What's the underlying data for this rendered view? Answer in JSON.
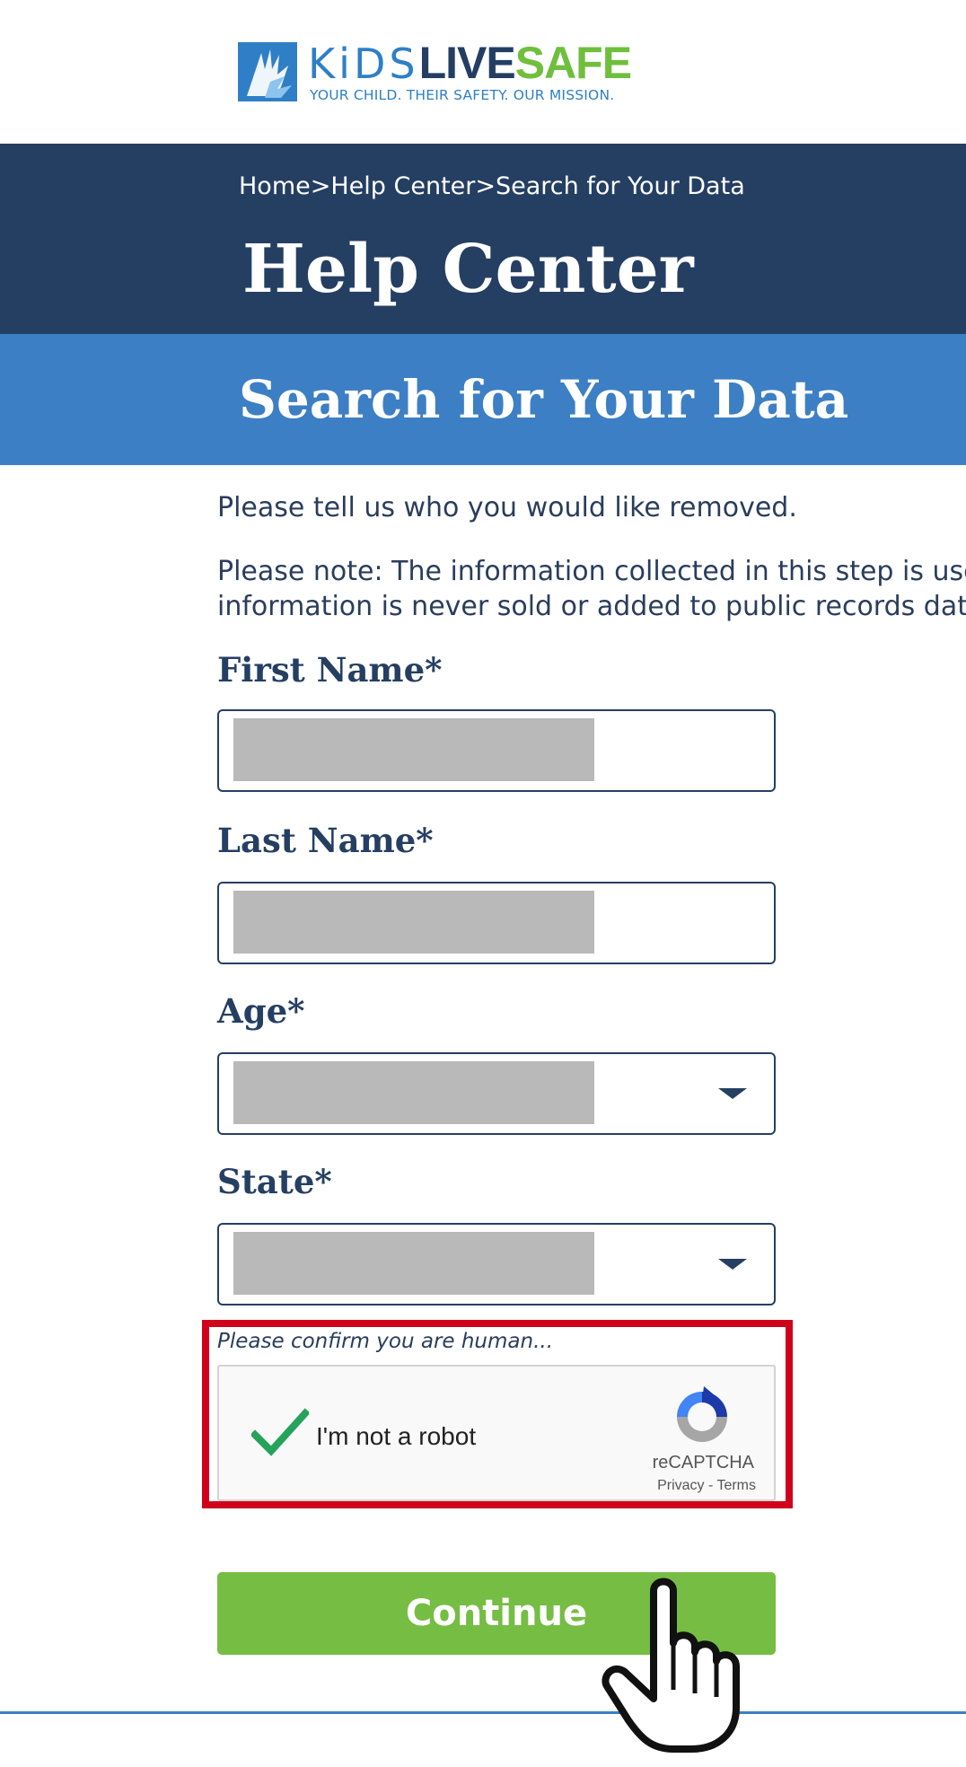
{
  "brand": {
    "kids": "KiDS",
    "live": "LIVE",
    "safe": "SAFE",
    "tagline": "YOUR CHILD. THEIR SAFETY. OUR MISSION.",
    "colors": {
      "blue": "#2f7fc6",
      "navy": "#243e63",
      "green": "#6fbf3d"
    }
  },
  "breadcrumb": {
    "home": "Home",
    "separator": ">",
    "help_center": "Help Center",
    "current": "Search for Your Data"
  },
  "header": {
    "title": "Help Center"
  },
  "section": {
    "title": "Search for Your Data"
  },
  "intro": "Please tell us who you would like removed.",
  "note": {
    "line1": "Please note: The information collected in this step is use",
    "line2": "information is never sold or added to public records data"
  },
  "form": {
    "first_name": {
      "label": "First Name*",
      "value": ""
    },
    "last_name": {
      "label": "Last Name*",
      "value": ""
    },
    "age": {
      "label": "Age*",
      "value": ""
    },
    "state": {
      "label": "State*",
      "value": ""
    }
  },
  "captcha": {
    "prompt": "Please confirm you are human...",
    "label": "I'm not a robot",
    "checked": true,
    "brand": "reCAPTCHA",
    "links": "Privacy - Terms"
  },
  "continue_label": "Continue",
  "colors": {
    "header_navy": "#253f63",
    "band_blue": "#3d7fc4",
    "button_green": "#75bd43",
    "highlight_red": "#d0021b"
  }
}
